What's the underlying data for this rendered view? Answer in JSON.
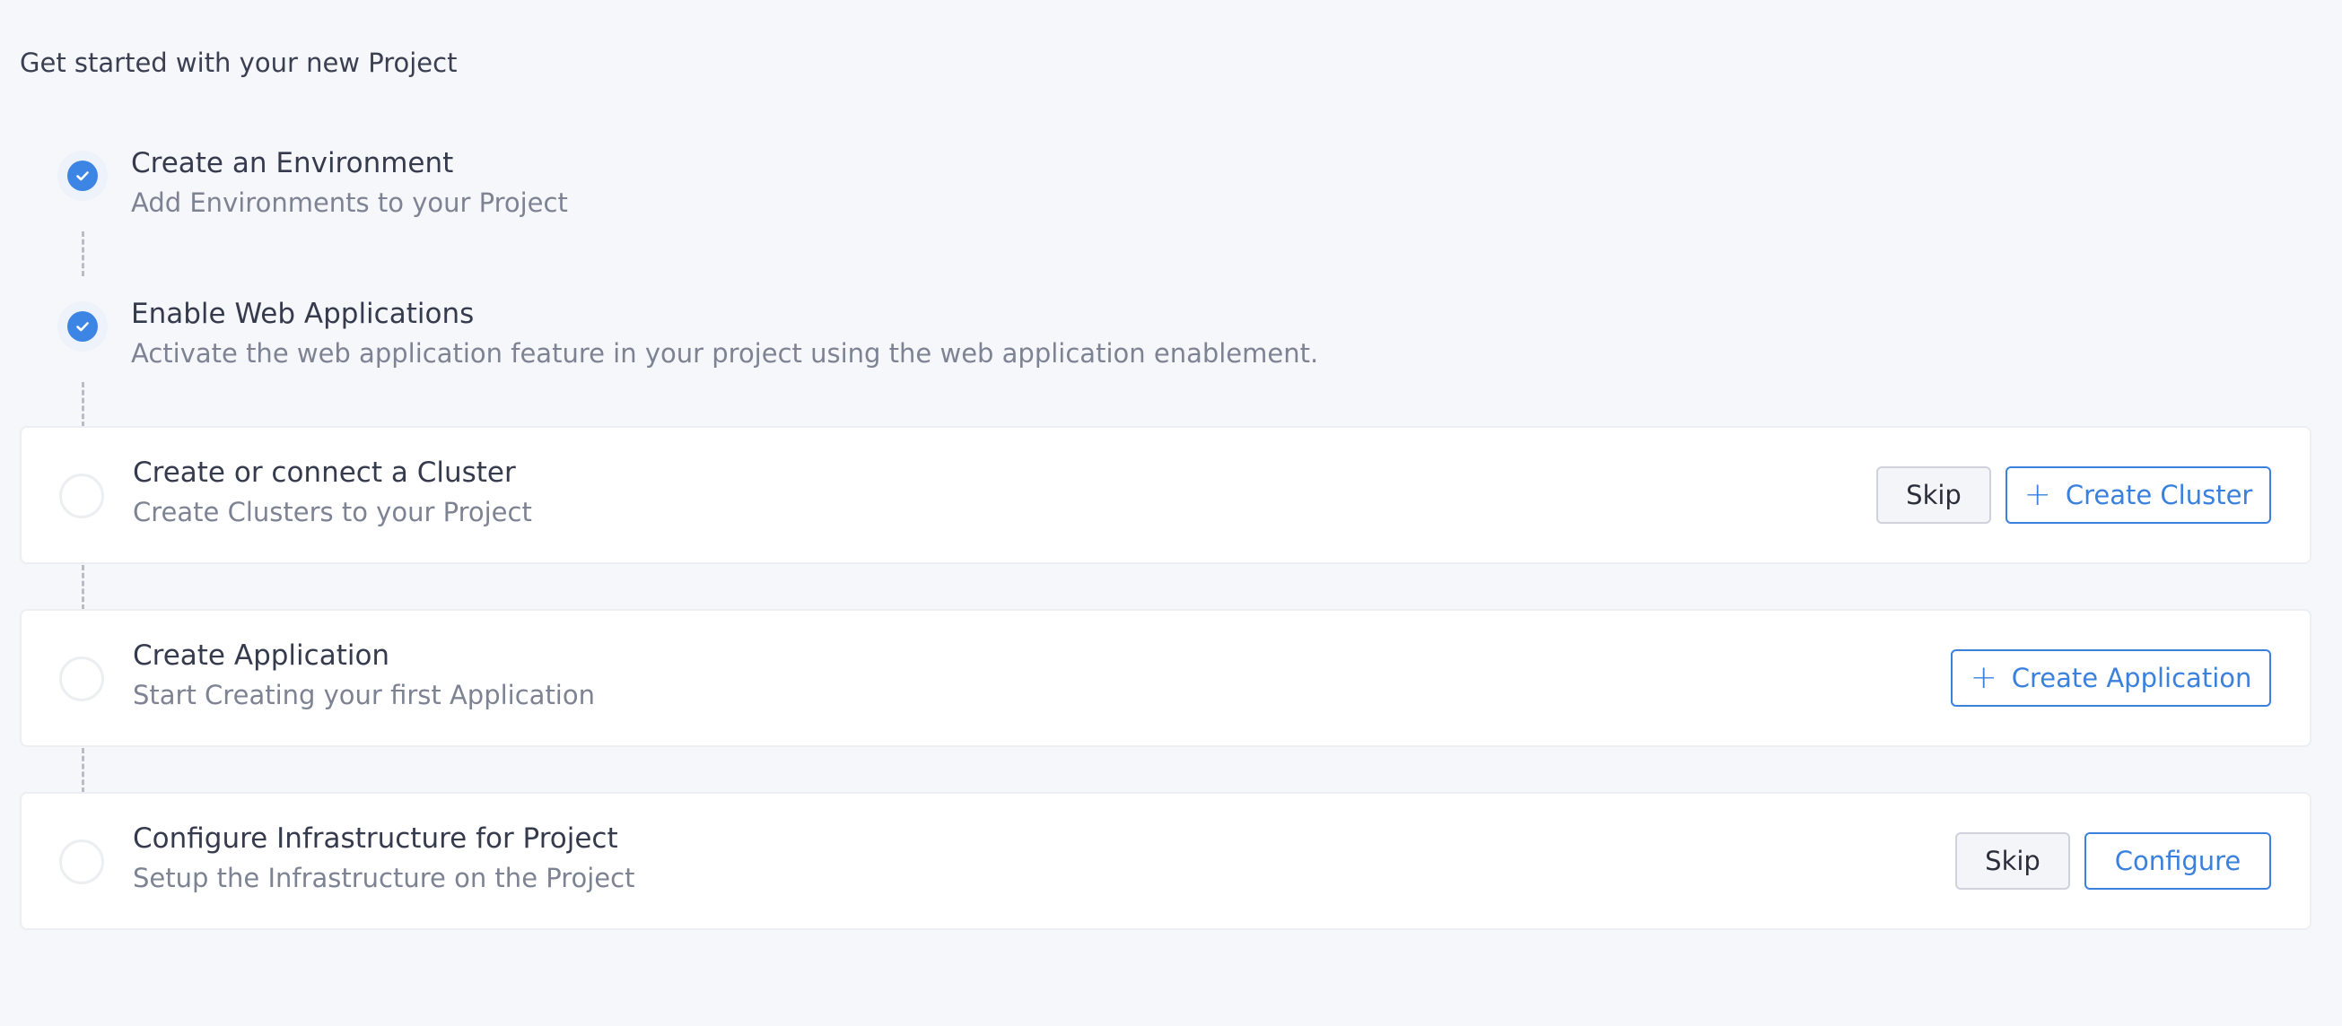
{
  "page": {
    "title": "Get started with your new Project"
  },
  "steps": [
    {
      "title": "Create an Environment",
      "description": "Add Environments to your Project",
      "status": "completed"
    },
    {
      "title": "Enable Web Applications",
      "description": "Activate the web application feature in your project using the web application enablement.",
      "status": "completed"
    },
    {
      "title": "Create or connect a Cluster",
      "description": "Create Clusters to your Project",
      "status": "pending",
      "skip_label": "Skip",
      "action_label": "Create Cluster",
      "action_icon": "plus-icon"
    },
    {
      "title": "Create Application",
      "description": "Start Creating your first Application",
      "status": "pending",
      "action_label": "Create Application",
      "action_icon": "plus-icon"
    },
    {
      "title": "Configure Infrastructure for Project",
      "description": "Setup the Infrastructure on the Project",
      "status": "pending",
      "skip_label": "Skip",
      "action_label": "Configure"
    }
  ],
  "colors": {
    "accent": "#3a80dd",
    "check_fill": "#3d85e5",
    "background": "#f6f7fb",
    "card": "#ffffff"
  }
}
